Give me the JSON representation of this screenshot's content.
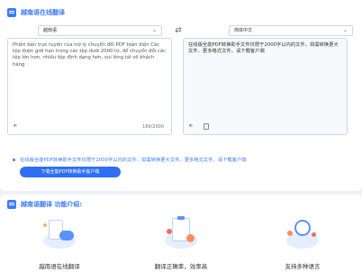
{
  "title": "越南语在线翻译",
  "source_lang": "越南语",
  "target_lang": "简体中文",
  "source_text": "Phiên bản trực tuyến của trợ lý chuyển đổi PDF toàn diện Các tệp được giới hạn trong các tệp dưới 2000 từ, để chuyển đổi các tệp lớn hơn, nhiều tệp định dạng hơn, vui lòng tải về khách hàng",
  "translated_text": "在线版全能PDF转换助手文件仅限于2000字以内的文件，如需转换更大文件、更多格式文件，请下载客户端",
  "char_count": "189/2000",
  "notice": "在线版全能PDF转换助手文件仅限于2000字以内的文件，如需转换更大文件、更多格式文件，请下载客户端",
  "cta_label": "下载全能PDF转换助手客户端",
  "intro_title": "越南语翻译 功能介绍:",
  "features": [
    {
      "label": "越南语在线翻译",
      "icon": "cloud-document-icon"
    },
    {
      "label": "翻译正确率，效率高",
      "icon": "clipboard-check-icon"
    },
    {
      "label": "支持多种语言",
      "icon": "globe-language-icon"
    }
  ],
  "colors": {
    "accent": "#3d7bfa",
    "button": "#2f6ff5"
  }
}
